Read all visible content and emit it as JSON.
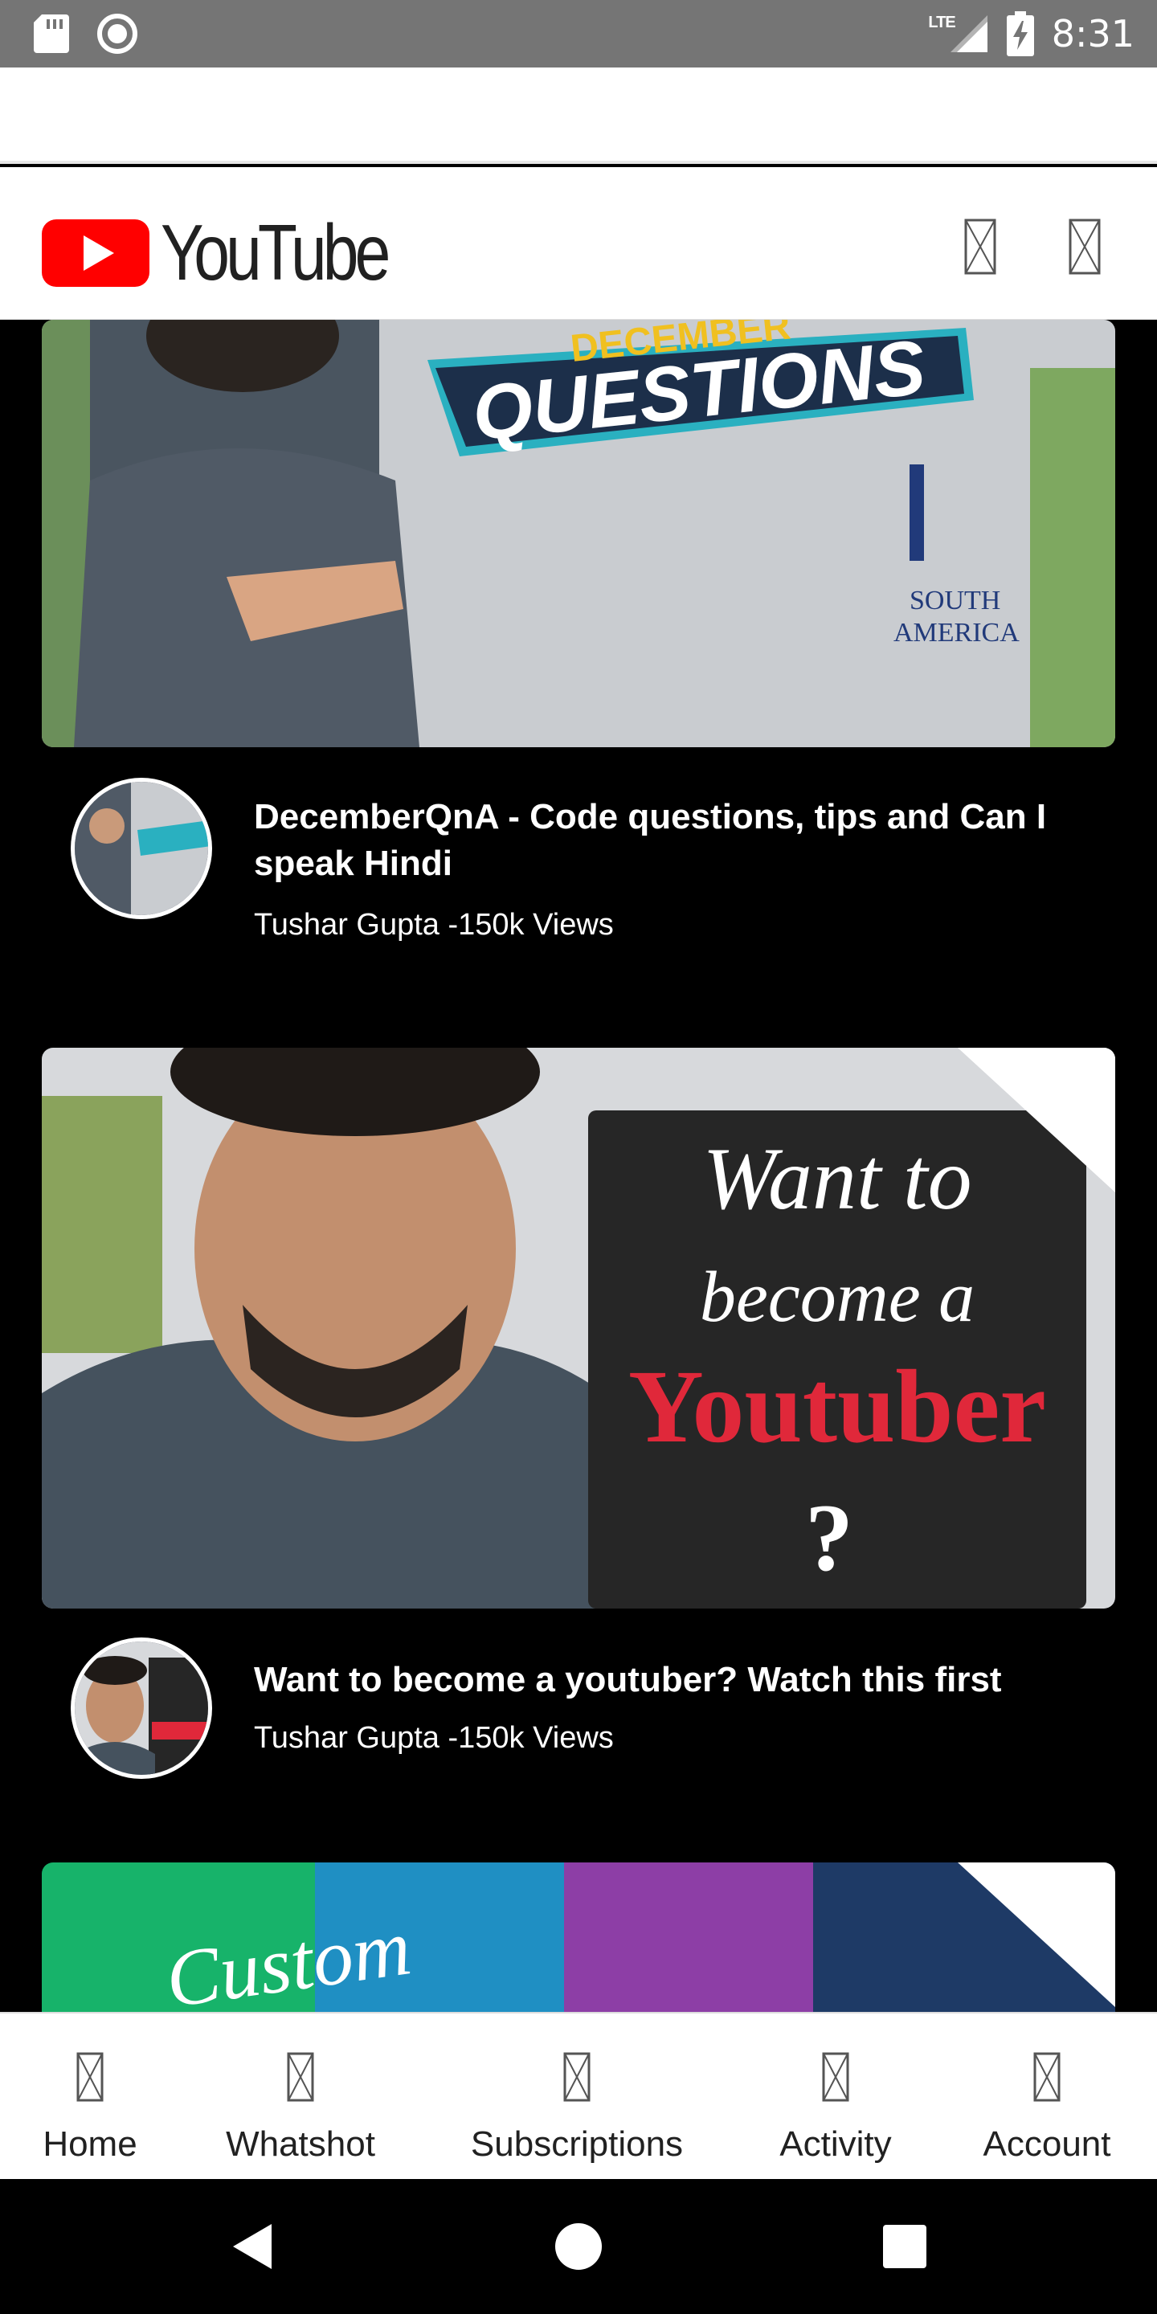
{
  "status_bar": {
    "time": "8:31",
    "network": "LTE",
    "icons": [
      "sd-card-icon",
      "circle-icon",
      "lte-signal-icon",
      "battery-charging-icon"
    ]
  },
  "header": {
    "logo_text": "YouTube",
    "icons": [
      "cast-icon",
      "search-icon"
    ]
  },
  "videos": [
    {
      "title": "DecemberQnA - Code questions, tips and Can I speak Hindi",
      "meta": "Tushar Gupta -150k Views",
      "thumb_caption_1": "DECEMBER",
      "thumb_caption_2": "QUESTIONS",
      "thumb_caption_3": "SOUTH",
      "thumb_caption_4": "AMERICA"
    },
    {
      "title": "Want to become a youtuber? Watch this first",
      "meta": "Tushar Gupta -150k Views",
      "thumb_caption_1": "Want to",
      "thumb_caption_2": "become a",
      "thumb_caption_3": "Youtuber",
      "thumb_caption_4": "?"
    },
    {
      "thumb_caption_1": "Custom"
    }
  ],
  "bottom_nav": [
    {
      "label": "Home",
      "icon": "home-icon"
    },
    {
      "label": "Whatshot",
      "icon": "whatshot-icon"
    },
    {
      "label": "Subscriptions",
      "icon": "subscriptions-icon"
    },
    {
      "label": "Activity",
      "icon": "activity-icon"
    },
    {
      "label": "Account",
      "icon": "account-icon"
    }
  ],
  "colors": {
    "status_bar": "#757575",
    "youtube_red": "#FF0000",
    "header_bg": "#FFFFFF",
    "feed_bg": "#000000",
    "text_primary": "#212121"
  }
}
